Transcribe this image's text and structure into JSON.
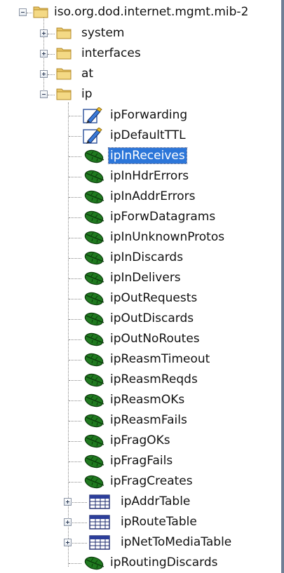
{
  "tree": {
    "root": {
      "label": "iso.org.dod.internet.mgmt.mib-2",
      "expanded": true,
      "icon": "folder-icon"
    },
    "children": [
      {
        "label": "system",
        "expanded": false,
        "icon": "folder-icon"
      },
      {
        "label": "interfaces",
        "expanded": false,
        "icon": "folder-icon"
      },
      {
        "label": "at",
        "expanded": false,
        "icon": "folder-icon"
      },
      {
        "label": "ip",
        "expanded": true,
        "icon": "folder-icon"
      }
    ],
    "ip_children": [
      {
        "label": "ipForwarding",
        "icon": "writable-object-icon"
      },
      {
        "label": "ipDefaultTTL",
        "icon": "writable-object-icon"
      },
      {
        "label": "ipInReceives",
        "icon": "leaf-icon",
        "selected": true
      },
      {
        "label": "ipInHdrErrors",
        "icon": "leaf-icon"
      },
      {
        "label": "ipInAddrErrors",
        "icon": "leaf-icon"
      },
      {
        "label": "ipForwDatagrams",
        "icon": "leaf-icon"
      },
      {
        "label": "ipInUnknownProtos",
        "icon": "leaf-icon"
      },
      {
        "label": "ipInDiscards",
        "icon": "leaf-icon"
      },
      {
        "label": "ipInDelivers",
        "icon": "leaf-icon"
      },
      {
        "label": "ipOutRequests",
        "icon": "leaf-icon"
      },
      {
        "label": "ipOutDiscards",
        "icon": "leaf-icon"
      },
      {
        "label": "ipOutNoRoutes",
        "icon": "leaf-icon"
      },
      {
        "label": "ipReasmTimeout",
        "icon": "leaf-icon"
      },
      {
        "label": "ipReasmReqds",
        "icon": "leaf-icon"
      },
      {
        "label": "ipReasmOKs",
        "icon": "leaf-icon"
      },
      {
        "label": "ipReasmFails",
        "icon": "leaf-icon"
      },
      {
        "label": "ipFragOKs",
        "icon": "leaf-icon"
      },
      {
        "label": "ipFragFails",
        "icon": "leaf-icon"
      },
      {
        "label": "ipFragCreates",
        "icon": "leaf-icon"
      },
      {
        "label": "ipAddrTable",
        "icon": "table-icon",
        "expanded": false
      },
      {
        "label": "ipRouteTable",
        "icon": "table-icon",
        "expanded": false
      },
      {
        "label": "ipNetToMediaTable",
        "icon": "table-icon",
        "expanded": false
      },
      {
        "label": "ipRoutingDiscards",
        "icon": "leaf-icon"
      }
    ]
  },
  "colors": {
    "selection": "#2c76d9",
    "leaf": "#1f7a1f",
    "folder": "#e8c566",
    "frame": "#6f7f95"
  }
}
